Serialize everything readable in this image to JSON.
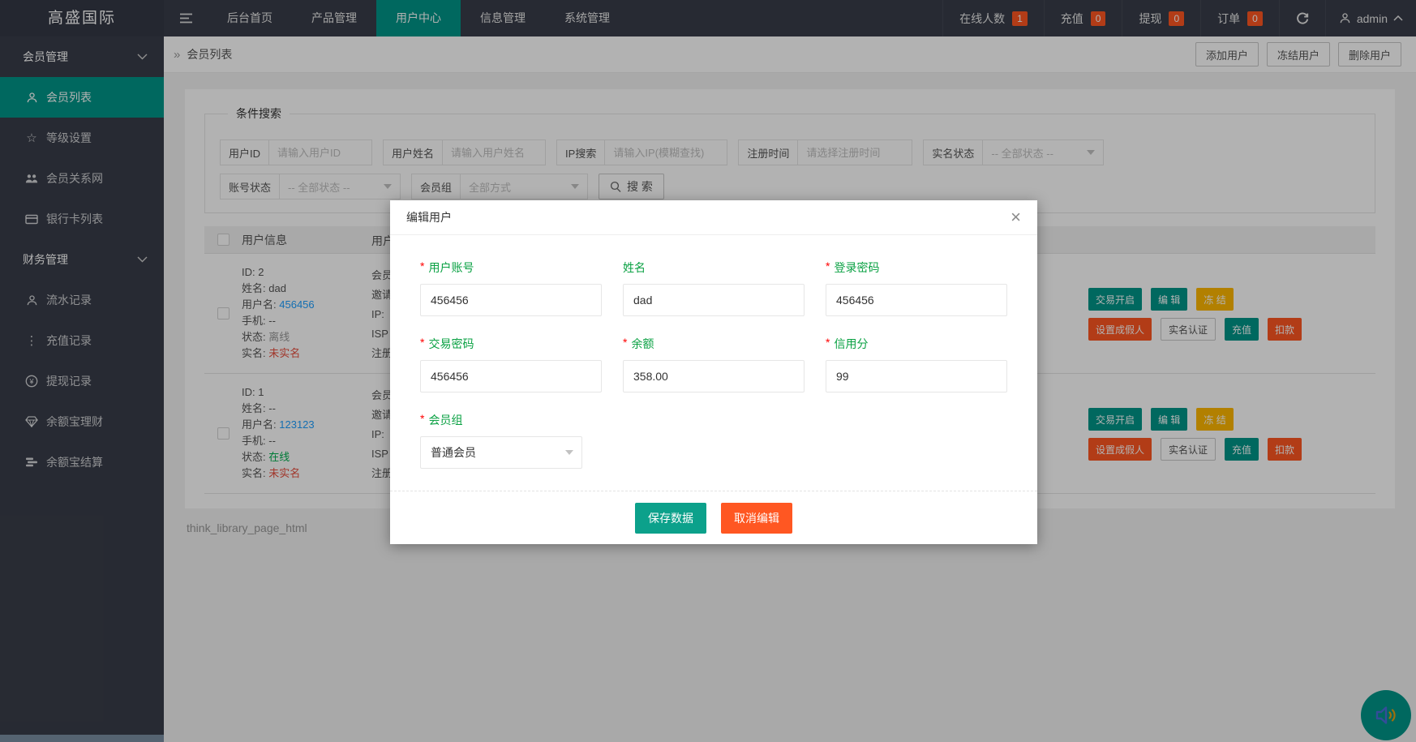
{
  "navbar": {
    "logo": "高盛国际",
    "menu": [
      {
        "label": "后台首页"
      },
      {
        "label": "产品管理"
      },
      {
        "label": "用户中心"
      },
      {
        "label": "信息管理"
      },
      {
        "label": "系统管理"
      }
    ],
    "stats": [
      {
        "label": "在线人数",
        "count": "1"
      },
      {
        "label": "充值",
        "count": "0"
      },
      {
        "label": "提现",
        "count": "0"
      },
      {
        "label": "订单",
        "count": "0"
      }
    ],
    "username": "admin"
  },
  "sidebar": {
    "groups": [
      {
        "label": "会员管理",
        "items": [
          {
            "label": "会员列表"
          },
          {
            "label": "等级设置"
          },
          {
            "label": "会员关系网"
          },
          {
            "label": "银行卡列表"
          }
        ]
      },
      {
        "label": "财务管理",
        "items": [
          {
            "label": "流水记录"
          },
          {
            "label": "充值记录"
          },
          {
            "label": "提现记录"
          },
          {
            "label": "余额宝理财"
          },
          {
            "label": "余额宝结算"
          }
        ]
      }
    ]
  },
  "breadcrumb": {
    "title": "会员列表"
  },
  "toolbar": {
    "add_label": "添加用户",
    "freeze_label": "冻结用户",
    "delete_label": "删除用户"
  },
  "search": {
    "legend": "条件搜索",
    "user_id": {
      "label": "用户ID",
      "placeholder": "请输入用户ID"
    },
    "user_name": {
      "label": "用户姓名",
      "placeholder": "请输入用户姓名"
    },
    "ip": {
      "label": "IP搜索",
      "placeholder": "请输入IP(模糊查找)"
    },
    "reg_time": {
      "label": "注册时间",
      "placeholder": "请选择注册时间"
    },
    "real_status": {
      "label": "实名状态",
      "value": "-- 全部状态 --"
    },
    "account_status": {
      "label": "账号状态",
      "value": "-- 全部状态 --"
    },
    "member_group": {
      "label": "会员组",
      "value": "全部方式"
    },
    "submit_label": "搜 索"
  },
  "table": {
    "headers": {
      "col_user": "用户信息",
      "col_detail": "用户"
    },
    "info_labels": {
      "id": "ID:",
      "name": "姓名:",
      "username": "用户名:",
      "phone": "手机:",
      "status": "状态:",
      "real": "实名:"
    },
    "detail_fragments": [
      "会员",
      "邀请",
      "IP:",
      "ISP",
      "注册"
    ],
    "rows": [
      {
        "id": "2",
        "name": "dad",
        "username": "456456",
        "phone": "--",
        "status": "离线",
        "real": "未实名"
      },
      {
        "id": "1",
        "name": "--",
        "username": "123123",
        "phone": "--",
        "status": "在线",
        "real": "未实名"
      }
    ],
    "actions": {
      "trade": "交易开启",
      "edit": "编 辑",
      "freeze": "冻 结",
      "fake": "设置成假人",
      "verify": "实名认证",
      "recharge": "充值",
      "deduct": "扣款"
    }
  },
  "footer_text": "think_library_page_html",
  "modal": {
    "title": "编辑用户",
    "close": "×",
    "fields": [
      {
        "label": "用户账号",
        "required": "*",
        "value": "456456"
      },
      {
        "label": "姓名",
        "required": "",
        "value": "dad"
      },
      {
        "label": "登录密码",
        "required": "*",
        "value": "456456"
      },
      {
        "label": "交易密码",
        "required": "*",
        "value": "456456"
      },
      {
        "label": "余额",
        "required": "*",
        "value": "358.00"
      },
      {
        "label": "信用分",
        "required": "*",
        "value": "99"
      }
    ],
    "group_field": {
      "label": "会员组",
      "required": "*",
      "value": "普通会员"
    },
    "save_label": "保存数据",
    "cancel_label": "取消编辑"
  },
  "colors": {
    "accent_teal": "#009688",
    "accent_orange": "#FF5722",
    "accent_yellow": "#FFB800",
    "link_blue": "#1E9FFF",
    "label_green": "#0aa143",
    "online_green": "#00b050",
    "offline_gray": "#999999",
    "danger_red": "#e74c3c",
    "dark_bg": "#393D49"
  }
}
